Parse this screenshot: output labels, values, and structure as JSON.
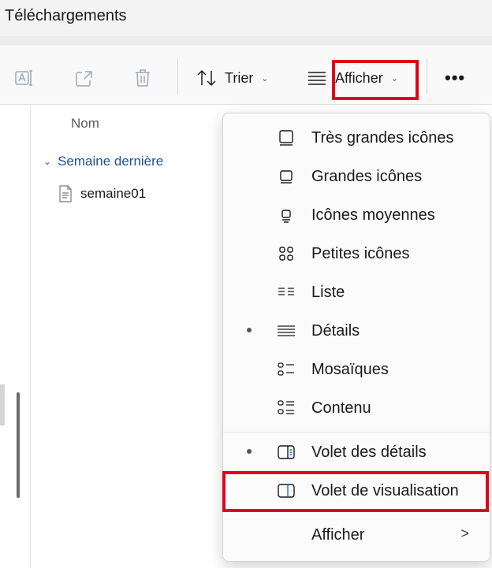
{
  "window": {
    "title": "Téléchargements"
  },
  "toolbar": {
    "rename_icon": "rename-icon",
    "share_icon": "share-icon",
    "delete_icon": "trash-icon",
    "sort_label": "Trier",
    "view_label": "Afficher",
    "more_label": "•••",
    "highlight_color": "#e0001a"
  },
  "file_list": {
    "column_header": "Nom",
    "groups": [
      {
        "label": "Semaine dernière",
        "items": [
          {
            "name": "semaine01",
            "icon": "document-icon"
          }
        ]
      }
    ]
  },
  "view_menu": {
    "items": [
      {
        "label": "Très grandes icônes",
        "icon": "extra-large-icons-icon",
        "selected": false
      },
      {
        "label": "Grandes icônes",
        "icon": "large-icons-icon",
        "selected": false
      },
      {
        "label": "Icônes moyennes",
        "icon": "medium-icons-icon",
        "selected": false
      },
      {
        "label": "Petites icônes",
        "icon": "small-icons-icon",
        "selected": false
      },
      {
        "label": "Liste",
        "icon": "list-icon",
        "selected": false
      },
      {
        "label": "Détails",
        "icon": "details-icon",
        "selected": true
      },
      {
        "label": "Mosaïques",
        "icon": "tiles-icon",
        "selected": false
      },
      {
        "label": "Contenu",
        "icon": "content-icon",
        "selected": false
      },
      {
        "label": "Volet des détails",
        "icon": "details-pane-icon",
        "selected": true
      },
      {
        "label": "Volet de visualisation",
        "icon": "preview-pane-icon",
        "selected": false,
        "highlighted": true
      },
      {
        "label": "Afficher",
        "icon": "",
        "selected": false,
        "submenu_arrow": ">"
      }
    ]
  }
}
